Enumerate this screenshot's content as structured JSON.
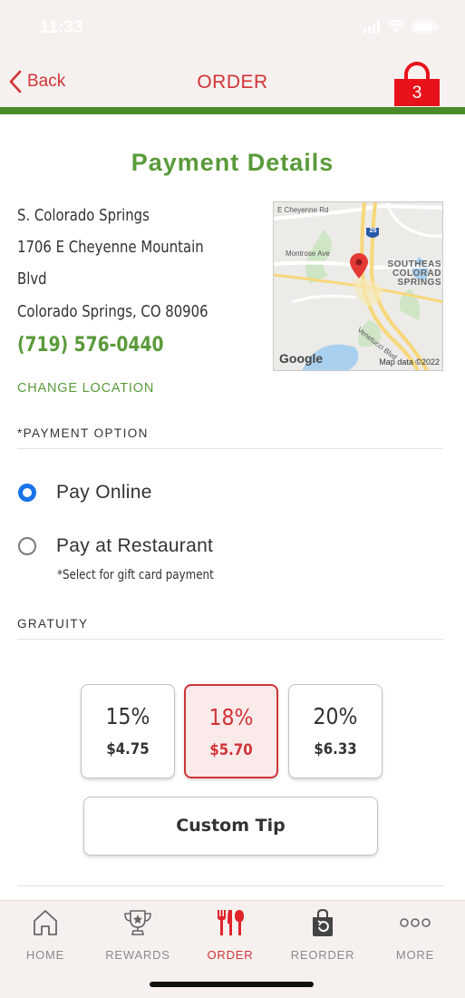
{
  "status": {
    "time": "11:33"
  },
  "header": {
    "back_label": "Back",
    "title": "ORDER",
    "cart_count": "3"
  },
  "page": {
    "title": "Payment Details"
  },
  "location": {
    "name": "S. Colorado Springs",
    "address_line1": "1706 E Cheyenne Mountain",
    "address_line2": "Blvd",
    "city_state_zip": "Colorado Springs, CO 80906",
    "phone": "(719) 576-0440",
    "change_label": "CHANGE LOCATION"
  },
  "map": {
    "street1": "E Cheyenne Rd",
    "street2": "Montrose Ave",
    "street3": "Venetucci Blvd",
    "highway": "25",
    "area_line1": "SOUTHEAS",
    "area_line2": "COLORAD",
    "area_line3": "SPRINGS",
    "google": "Google",
    "attribution": "Map data ©2022"
  },
  "payment": {
    "section_label": "*PAYMENT OPTION",
    "options": [
      {
        "label": "Pay Online",
        "selected": true
      },
      {
        "label": "Pay at Restaurant",
        "selected": false
      }
    ],
    "note": "*Select for gift card payment"
  },
  "gratuity": {
    "section_label": "GRATUITY",
    "options": [
      {
        "percent": "15%",
        "amount": "$4.75",
        "selected": false
      },
      {
        "percent": "18%",
        "amount": "$5.70",
        "selected": true
      },
      {
        "percent": "20%",
        "amount": "$6.33",
        "selected": false
      }
    ],
    "custom_label": "Custom Tip"
  },
  "tabs": [
    {
      "label": "HOME",
      "icon": "home-icon"
    },
    {
      "label": "REWARDS",
      "icon": "trophy-icon"
    },
    {
      "label": "ORDER",
      "icon": "utensils-icon",
      "active": true
    },
    {
      "label": "REORDER",
      "icon": "reorder-bag-icon"
    },
    {
      "label": "MORE",
      "icon": "more-dots-icon"
    }
  ],
  "colors": {
    "brand_red": "#d13438",
    "brand_green": "#5a9a3a",
    "radio_blue": "#1a73e8"
  }
}
